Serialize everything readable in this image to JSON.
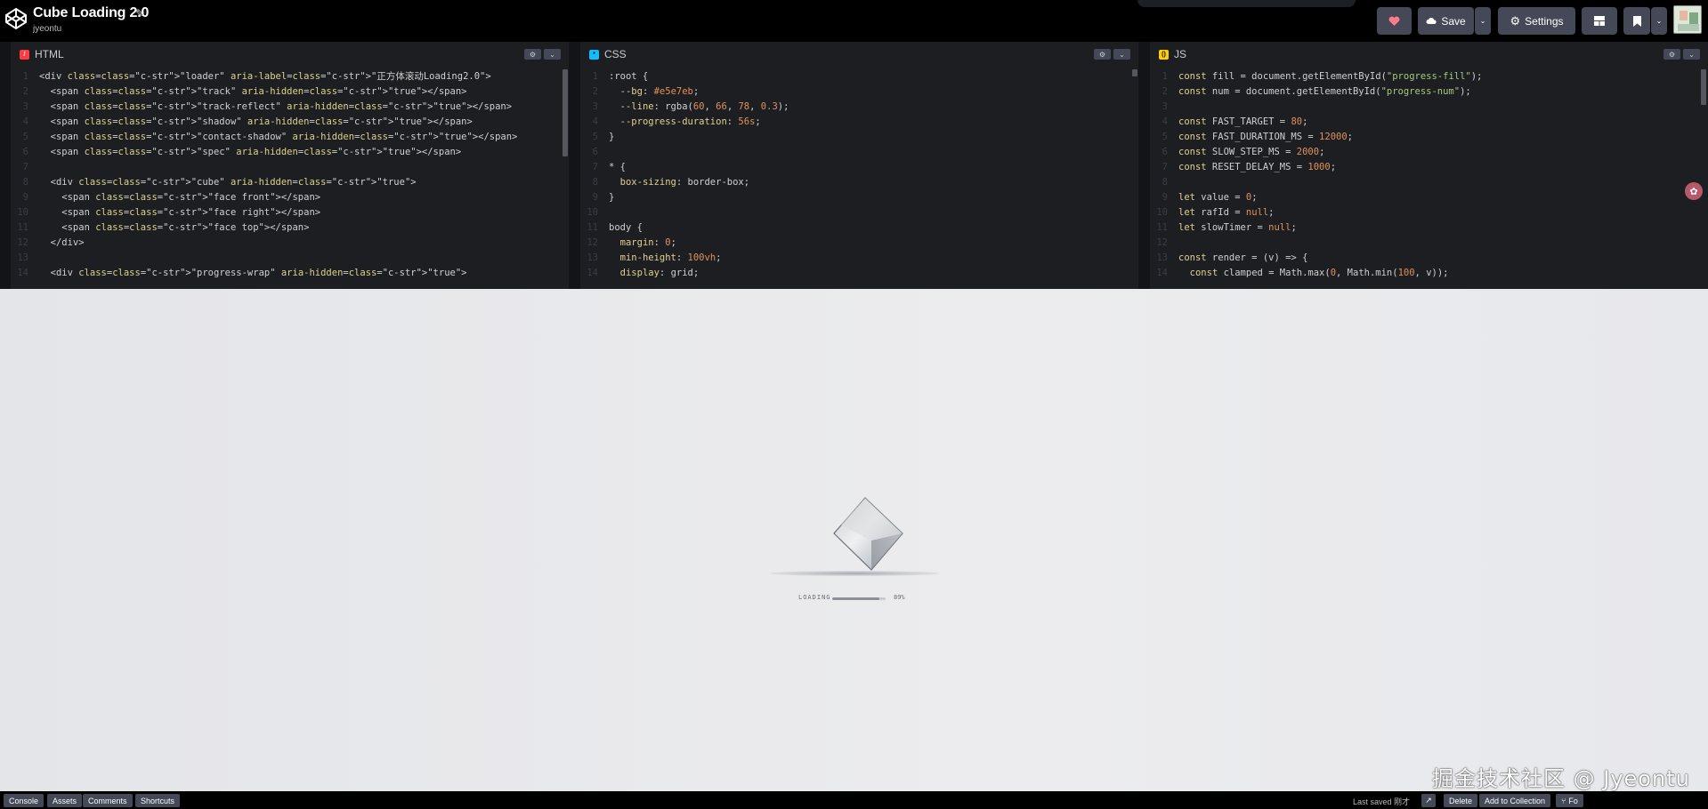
{
  "header": {
    "title": "Cube Loading 2.0",
    "author": "jyeontu",
    "buttons": {
      "save": "Save",
      "settings": "Settings"
    },
    "icons": [
      "codepen-logo-icon",
      "pencil-icon",
      "heart-icon",
      "cloud-icon",
      "chevron-down-icon",
      "gear-icon",
      "layout-grid-icon",
      "bookmark-icon"
    ]
  },
  "panes": {
    "html": {
      "label": "HTML",
      "badge": "/",
      "badge_color": "#ff3c41",
      "lines": [
        "<div class=\"loader\" aria-label=\"正方体滚动Loading2.0\">",
        "  <span class=\"track\" aria-hidden=\"true\"></span>",
        "  <span class=\"track-reflect\" aria-hidden=\"true\"></span>",
        "  <span class=\"shadow\" aria-hidden=\"true\"></span>",
        "  <span class=\"contact-shadow\" aria-hidden=\"true\"></span>",
        "  <span class=\"spec\" aria-hidden=\"true\"></span>",
        "",
        "  <div class=\"cube\" aria-hidden=\"true\">",
        "    <span class=\"face front\"></span>",
        "    <span class=\"face right\"></span>",
        "    <span class=\"face top\"></span>",
        "  </div>",
        "",
        "  <div class=\"progress-wrap\" aria-hidden=\"true\">"
      ]
    },
    "css": {
      "label": "CSS",
      "badge": "*",
      "badge_color": "#0ebeff",
      "lines": [
        ":root {",
        "  --bg: #e5e7eb;",
        "  --line: rgba(60, 66, 78, 0.3);",
        "  --progress-duration: 56s;",
        "}",
        "",
        "* {",
        "  box-sizing: border-box;",
        "}",
        "",
        "body {",
        "  margin: 0;",
        "  min-height: 100vh;",
        "  display: grid;"
      ]
    },
    "js": {
      "label": "JS",
      "badge": "()",
      "badge_color": "#fcd000",
      "lines": [
        "const fill = document.getElementById(\"progress-fill\");",
        "const num = document.getElementById(\"progress-num\");",
        "",
        "const FAST_TARGET = 80;",
        "const FAST_DURATION_MS = 12000;",
        "const SLOW_STEP_MS = 2000;",
        "const RESET_DELAY_MS = 1000;",
        "",
        "let value = 0;",
        "let rafId = null;",
        "let slowTimer = null;",
        "",
        "const render = (v) => {",
        "  const clamped = Math.max(0, Math.min(100, v));"
      ]
    }
  },
  "preview": {
    "loading_label": "LOADING",
    "progress_value": 89,
    "progress_text": "89%",
    "watermark": "掘金技术社区 @ Jyeontu"
  },
  "footer": {
    "buttons": [
      "Console",
      "Assets",
      "Comments",
      "Shortcuts"
    ],
    "last_saved": "Last saved 刚才",
    "right_buttons": [
      "Delete",
      "Add to Collection"
    ],
    "fork_label": "Fo"
  },
  "colors": {
    "header_bg": "#000000",
    "editor_bg": "#1d1e22",
    "button_bg": "#444857",
    "preview_bg": "#e6e7eb",
    "heart": "#ff3c41"
  }
}
